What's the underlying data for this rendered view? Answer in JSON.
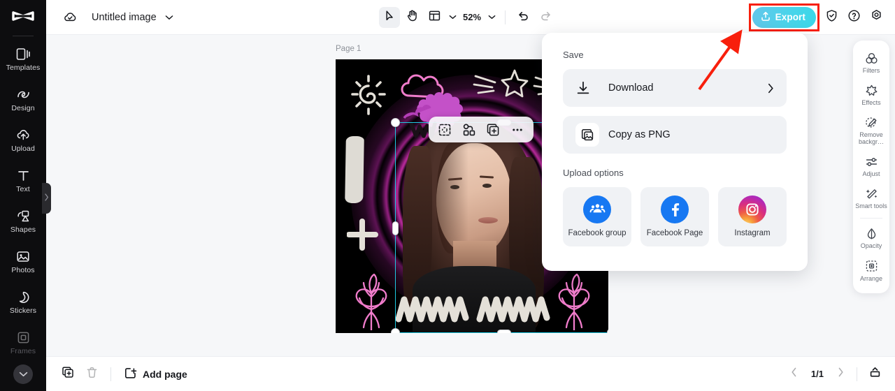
{
  "app": {
    "brand_icon": "capcut-logo-icon",
    "accent_export": "#4ad4ea",
    "highlight_color": "#f81f0c",
    "selection_color": "#1ec8e0"
  },
  "left_sidebar": {
    "items": [
      {
        "label": "Templates",
        "icon": "templates-icon"
      },
      {
        "label": "Design",
        "icon": "design-icon"
      },
      {
        "label": "Upload",
        "icon": "upload-cloud-icon"
      },
      {
        "label": "Text",
        "icon": "text-icon"
      },
      {
        "label": "Shapes",
        "icon": "shapes-icon"
      },
      {
        "label": "Photos",
        "icon": "photos-icon"
      },
      {
        "label": "Stickers",
        "icon": "stickers-icon"
      },
      {
        "label": "Frames",
        "icon": "frames-icon"
      }
    ],
    "expand_icon": "chevron-down-icon",
    "collapse_icon": "chevron-right-icon"
  },
  "topbar": {
    "cloud_icon": "cloud-saved-icon",
    "doc_title": "Untitled image",
    "doc_caret_icon": "chevron-down-icon",
    "tools": [
      {
        "name": "select-tool",
        "icon": "cursor-arrow-icon",
        "active": true
      },
      {
        "name": "hand-tool",
        "icon": "hand-icon",
        "active": false
      },
      {
        "name": "layout-tool",
        "icon": "layout-grid-icon",
        "active": false
      }
    ],
    "layout_caret_icon": "chevron-down-icon",
    "zoom_level": "52%",
    "zoom_caret_icon": "chevron-down-icon",
    "undo_icon": "undo-icon",
    "redo_icon": "redo-icon",
    "export_label": "Export",
    "export_icon": "upload-box-icon",
    "shield_icon": "shield-check-icon",
    "help_icon": "help-circle-icon",
    "settings_icon": "settings-gear-icon"
  },
  "canvas": {
    "page_label": "Page 1",
    "floating_toolbar": [
      {
        "name": "cutout-icon"
      },
      {
        "name": "shape-arrange-icon"
      },
      {
        "name": "duplicate-layer-icon"
      },
      {
        "name": "more-options-icon"
      }
    ],
    "rotate_icon": "rotate-icon"
  },
  "export_panel": {
    "save_section": "Save",
    "rows": [
      {
        "label": "Download",
        "icon": "download-icon",
        "chevron": "chevron-right-icon",
        "has_chevron": true
      },
      {
        "label": "Copy as PNG",
        "icon": "copy-image-icon",
        "has_chevron": false
      }
    ],
    "upload_section": "Upload options",
    "upload_options": [
      {
        "label": "Facebook group",
        "icon": "facebook-group-icon",
        "color": "#1778f2"
      },
      {
        "label": "Facebook Page",
        "icon": "facebook-page-icon",
        "color": "#1778f2"
      },
      {
        "label": "Instagram",
        "icon": "instagram-icon",
        "color": "#d6249f"
      }
    ]
  },
  "right_panel": {
    "items": [
      {
        "label": "Filters",
        "icon": "filters-icon"
      },
      {
        "label": "Effects",
        "icon": "effects-icon"
      },
      {
        "label": "Remove backgr…",
        "icon": "remove-background-icon"
      },
      {
        "label": "Adjust",
        "icon": "adjust-icon"
      },
      {
        "label": "Smart tools",
        "icon": "smart-tools-icon"
      }
    ],
    "items_bottom": [
      {
        "label": "Opacity",
        "icon": "opacity-icon"
      },
      {
        "label": "Arrange",
        "icon": "arrange-icon"
      }
    ]
  },
  "bottombar": {
    "duplicate_icon": "duplicate-page-icon",
    "delete_icon": "trash-icon",
    "add_page_label": "Add page",
    "add_page_icon": "add-page-icon",
    "prev_icon": "chevron-left-icon",
    "page_indicator": "1/1",
    "next_icon": "chevron-right-icon",
    "present_icon": "present-icon"
  }
}
